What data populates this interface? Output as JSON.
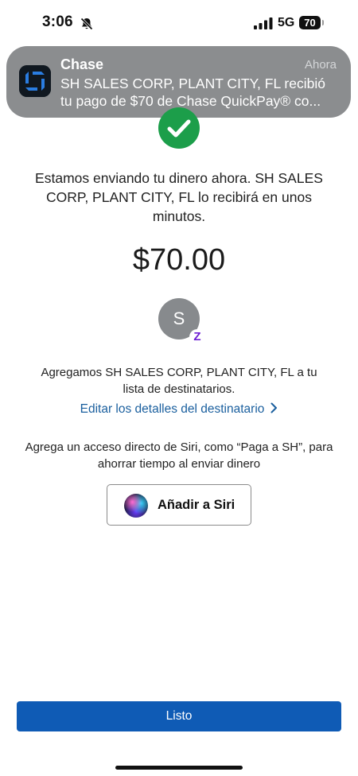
{
  "status_bar": {
    "time": "3:06",
    "network": "5G",
    "battery": "70"
  },
  "notification": {
    "app_name": "Chase",
    "time": "Ahora",
    "line1": "SH SALES CORP, PLANT CITY, FL recibió",
    "line2": "tu pago de $70 de Chase QuickPay® co..."
  },
  "main": {
    "message": "Estamos enviando tu dinero ahora. SH SALES CORP, PLANT CITY, FL lo recibirá en unos minutos.",
    "amount": "$70.00",
    "avatar_initial": "S",
    "zelle_badge": "Z",
    "recipient_added": "Agregamos SH SALES CORP, PLANT CITY, FL a tu lista de destinatarios.",
    "edit_link": "Editar los detalles del destinatario",
    "siri_text": "Agrega un acceso directo de Siri, como “Paga a SH”, para ahorrar tiempo al enviar dinero",
    "siri_button": "Añadir a Siri"
  },
  "footer": {
    "done_label": "Listo"
  },
  "colors": {
    "primary_button": "#0f5bb5",
    "link": "#1a5f9e",
    "success": "#1c9e4a",
    "zelle": "#6d1ed4",
    "notification_bg": "#8b8d8f"
  },
  "icons": [
    "bell-off-icon",
    "signal-icon",
    "battery-icon",
    "chase-logo-icon",
    "checkmark-icon",
    "zelle-icon",
    "chevron-right-icon",
    "siri-orb-icon"
  ]
}
